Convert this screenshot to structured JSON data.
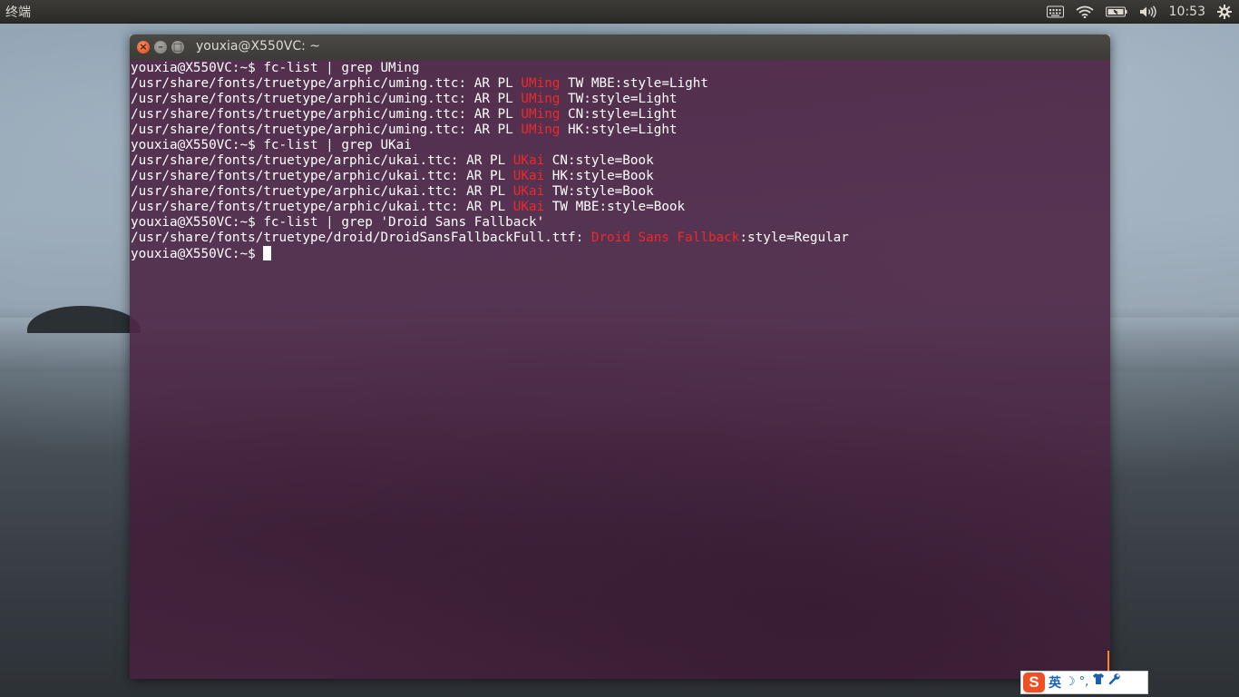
{
  "top_panel": {
    "app_title": "终端",
    "clock": "10:53",
    "indicators": [
      "keyboard-icon",
      "wifi-icon",
      "battery-icon",
      "volume-icon",
      "gear-icon"
    ]
  },
  "window": {
    "title": "youxia@X550VC: ~",
    "buttons": [
      "close-icon",
      "minimize-icon",
      "maximize-icon"
    ]
  },
  "terminal": {
    "lines": [
      [
        {
          "t": "youxia@X550VC:~$ fc-list | grep UMing"
        }
      ],
      [
        {
          "t": "/usr/share/fonts/truetype/arphic/uming.ttc: AR PL "
        },
        {
          "t": "UMing",
          "hl": true
        },
        {
          "t": " TW MBE:style=Light"
        }
      ],
      [
        {
          "t": "/usr/share/fonts/truetype/arphic/uming.ttc: AR PL "
        },
        {
          "t": "UMing",
          "hl": true
        },
        {
          "t": " TW:style=Light"
        }
      ],
      [
        {
          "t": "/usr/share/fonts/truetype/arphic/uming.ttc: AR PL "
        },
        {
          "t": "UMing",
          "hl": true
        },
        {
          "t": " CN:style=Light"
        }
      ],
      [
        {
          "t": "/usr/share/fonts/truetype/arphic/uming.ttc: AR PL "
        },
        {
          "t": "UMing",
          "hl": true
        },
        {
          "t": " HK:style=Light"
        }
      ],
      [
        {
          "t": "youxia@X550VC:~$ fc-list | grep UKai"
        }
      ],
      [
        {
          "t": "/usr/share/fonts/truetype/arphic/ukai.ttc: AR PL "
        },
        {
          "t": "UKai",
          "hl": true
        },
        {
          "t": " CN:style=Book"
        }
      ],
      [
        {
          "t": "/usr/share/fonts/truetype/arphic/ukai.ttc: AR PL "
        },
        {
          "t": "UKai",
          "hl": true
        },
        {
          "t": " HK:style=Book"
        }
      ],
      [
        {
          "t": "/usr/share/fonts/truetype/arphic/ukai.ttc: AR PL "
        },
        {
          "t": "UKai",
          "hl": true
        },
        {
          "t": " TW:style=Book"
        }
      ],
      [
        {
          "t": "/usr/share/fonts/truetype/arphic/ukai.ttc: AR PL "
        },
        {
          "t": "UKai",
          "hl": true
        },
        {
          "t": " TW MBE:style=Book"
        }
      ],
      [
        {
          "t": "youxia@X550VC:~$ fc-list | grep 'Droid Sans Fallback'"
        }
      ],
      [
        {
          "t": "/usr/share/fonts/truetype/droid/DroidSansFallbackFull.ttf: "
        },
        {
          "t": "Droid Sans Fallback",
          "hl": true
        },
        {
          "t": ":style=Regular"
        }
      ],
      [
        {
          "t": "youxia@X550VC:~$ "
        },
        {
          "cursor": true
        }
      ]
    ],
    "highlight_color": "#ef2929",
    "text_color": "#ffffff"
  },
  "ime": {
    "logo": "S",
    "mode": "英",
    "icons": [
      "moon-icon",
      "punctuation-icon",
      "shirt-icon",
      "wrench-icon"
    ]
  }
}
